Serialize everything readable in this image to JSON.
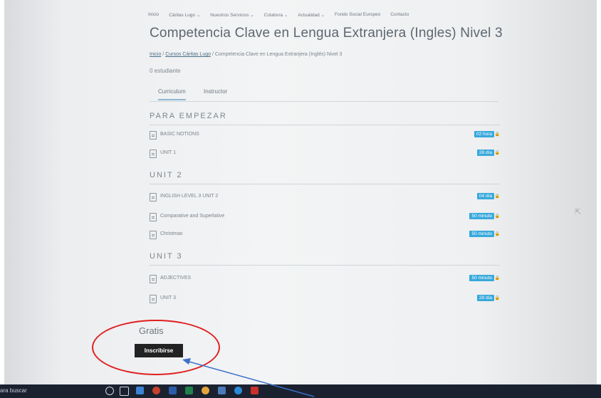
{
  "nav": [
    "Inicio",
    "Cáritas Lugo ⌄",
    "Nuestros Servicios ⌄",
    "Colabora ⌄",
    "Actualidad ⌄",
    "Fondo Social Europeo",
    "Contacto"
  ],
  "page_title": "Competencia Clave en Lengua Extranjera (Ingles) Nivel 3",
  "breadcrumb": {
    "home": "Inicio",
    "sep1": " / ",
    "courses": "Cursos Cáritas Lugo",
    "sep2": " / ",
    "current": "Competencia Clave en Lengua Extranjera (Inglés) Nivel 3"
  },
  "students": "0 estudiante",
  "tabs": {
    "curriculum": "Curriculum",
    "instructor": "Instructor"
  },
  "sections": [
    {
      "title": "PARA EMPEZAR",
      "lessons": [
        {
          "title": "BASIC NOTIONS",
          "duration": "02 hora"
        },
        {
          "title": "UNIT 1",
          "duration": "28 día"
        }
      ]
    },
    {
      "title": "UNIT 2",
      "lessons": [
        {
          "title": "INGLISH LEVEL 3 UNIT 2",
          "duration": "04 día"
        },
        {
          "title": "Comparative and Superlative",
          "duration": "50 minuto"
        },
        {
          "title": "Christmas",
          "duration": "50 minuto"
        }
      ]
    },
    {
      "title": "UNIT 3",
      "lessons": [
        {
          "title": "ADJECTIVES",
          "duration": "50 minuto"
        },
        {
          "title": "UNIT 3",
          "duration": "28 día"
        }
      ]
    }
  ],
  "price": "Gratis",
  "enroll_label": "Inscribirse",
  "taskbar": {
    "search_text": "ara buscar"
  },
  "colors": {
    "badge": "#38a9dc",
    "annotation_ellipse": "#e02020",
    "annotation_arrow": "#3b6fc9"
  }
}
